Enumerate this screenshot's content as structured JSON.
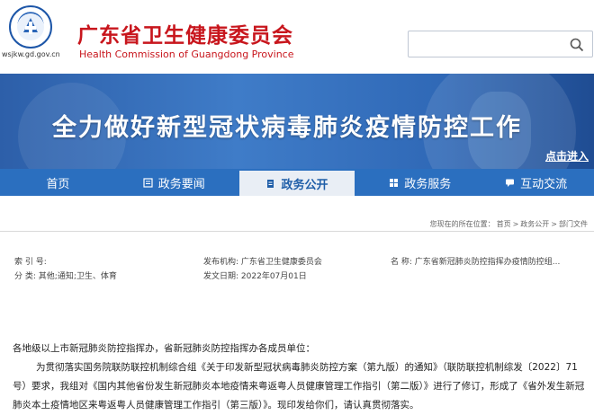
{
  "header": {
    "org_cn": "广东省卫生健康委员会",
    "org_en": "Health Commission of Guangdong Province",
    "site_url": "wsjkw.gd.gov.cn",
    "search_placeholder": ""
  },
  "banner": {
    "title": "全力做好新型冠状病毒肺炎疫情防控工作",
    "link": "点击进入"
  },
  "nav": {
    "items": [
      {
        "label": "首页"
      },
      {
        "label": "政务要闻"
      },
      {
        "label": "政务公开"
      },
      {
        "label": "政务服务"
      },
      {
        "label": "互动交流"
      }
    ]
  },
  "breadcrumb": {
    "prefix": "您现在的所在位置：",
    "items": [
      "首页",
      "政务公开",
      "部门文件"
    ],
    "sep": ">"
  },
  "meta": {
    "index_label": "索 引 号:",
    "category_label": "分  类:",
    "category_value": "其他;通知;卫生、体育",
    "publisher_label": "发布机构:",
    "publisher_value": "广东省卫生健康委员会",
    "date_label": "发文日期:",
    "date_value": "2022年07月01日",
    "name_label": "名",
    "name_value": "称:  广东省新冠肺炎防控指挥办疫情防控组..."
  },
  "content": {
    "salutation": "各地级以上市新冠肺炎防控指挥办，省新冠肺炎防控指挥办各成员单位：",
    "paragraph": "为贯彻落实国务院联防联控机制综合组《关于印发新型冠状病毒肺炎防控方案（第九版）的通知》（联防联控机制综发〔2022〕71号）要求，我组对《国内其他省份发生新冠肺炎本地疫情来粤返粤人员健康管理工作指引（第二版）》进行了修订，形成了《省外发生新冠肺炎本土疫情地区来粤返粤人员健康管理工作指引（第三版）》。现印发给你们，请认真贯彻落实。"
  },
  "colors": {
    "brand_red": "#c8161d",
    "nav_blue": "#2b6fbf",
    "banner_blue": "#3f7cc8"
  }
}
